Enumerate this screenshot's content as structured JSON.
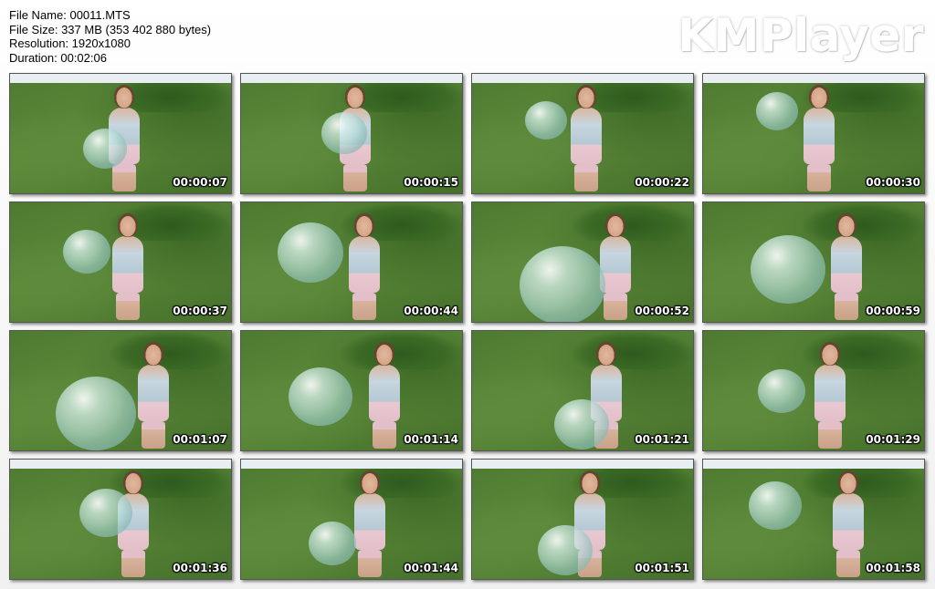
{
  "info": {
    "file_name": "File Name: 00011.MTS",
    "file_size": "File Size: 337 MB (353 402 880 bytes)",
    "resolution": "Resolution: 1920x1080",
    "duration": "Duration: 00:02:06"
  },
  "brand": "KMPlayer",
  "thumbnails": [
    {
      "time": "00:00:07"
    },
    {
      "time": "00:00:15"
    },
    {
      "time": "00:00:22"
    },
    {
      "time": "00:00:30"
    },
    {
      "time": "00:00:37"
    },
    {
      "time": "00:00:44"
    },
    {
      "time": "00:00:52"
    },
    {
      "time": "00:00:59"
    },
    {
      "time": "00:01:07"
    },
    {
      "time": "00:01:14"
    },
    {
      "time": "00:01:21"
    },
    {
      "time": "00:01:29"
    },
    {
      "time": "00:01:36"
    },
    {
      "time": "00:01:44"
    },
    {
      "time": "00:01:51"
    },
    {
      "time": "00:01:58"
    }
  ]
}
